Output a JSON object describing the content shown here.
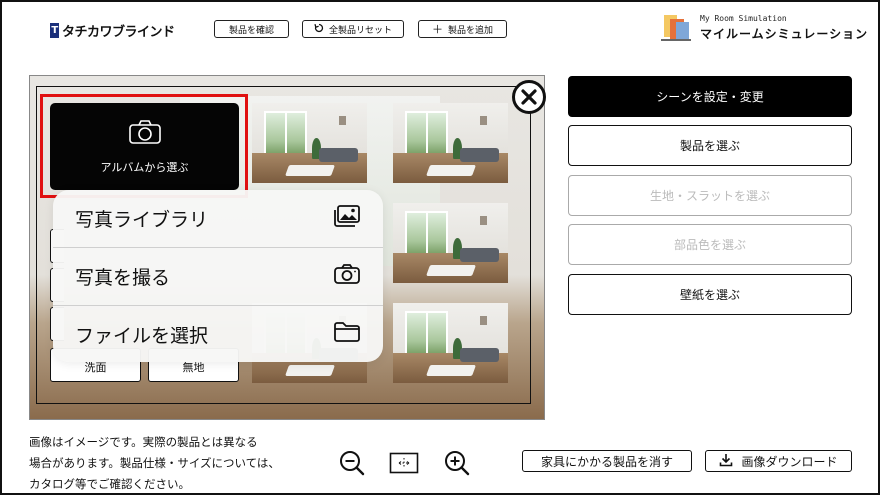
{
  "header": {
    "logo_mark": "T",
    "logo_text": "タチカワブラインド",
    "buttons": [
      {
        "label": "製品を確認",
        "icon": ""
      },
      {
        "label": "全製品リセット",
        "icon": "reset-icon"
      },
      {
        "label": "製品を追加",
        "icon": "plus-icon"
      }
    ],
    "brand_en": "My Room Simulation",
    "brand_jp": "マイルームシミュレーション"
  },
  "album": {
    "label": "アルバムから選ぶ",
    "icon": "camera-icon",
    "highlight_color": "#e01010"
  },
  "photo_menu": [
    {
      "label": "写真ライブラリ",
      "icon": "photo-library-icon"
    },
    {
      "label": "写真を撮る",
      "icon": "camera-icon"
    },
    {
      "label": "ファイルを選択",
      "icon": "folder-icon"
    }
  ],
  "fabric_chips": [
    "洗面",
    "無地"
  ],
  "right_panel": [
    {
      "label": "シーンを設定・変更",
      "state": "active"
    },
    {
      "label": "製品を選ぶ",
      "state": "enabled"
    },
    {
      "label": "生地・スラットを選ぶ",
      "state": "disabled"
    },
    {
      "label": "部品色を選ぶ",
      "state": "disabled"
    },
    {
      "label": "壁紙を選ぶ",
      "state": "enabled"
    }
  ],
  "footer": {
    "note_lines": [
      "画像はイメージです。実際の製品とは異なる",
      "場合があります。製品仕様・サイズについては、",
      "カタログ等でご確認ください。"
    ],
    "zoom_icons": [
      "zoom-out-icon",
      "fit-screen-icon",
      "zoom-in-icon"
    ],
    "clear_furniture_label": "家具にかかる製品を消す",
    "download_label": "画像ダウンロード"
  },
  "colors": {
    "primary": "#000000",
    "logo_blue": "#1a2f7a",
    "disabled": "#bbbbbb"
  }
}
